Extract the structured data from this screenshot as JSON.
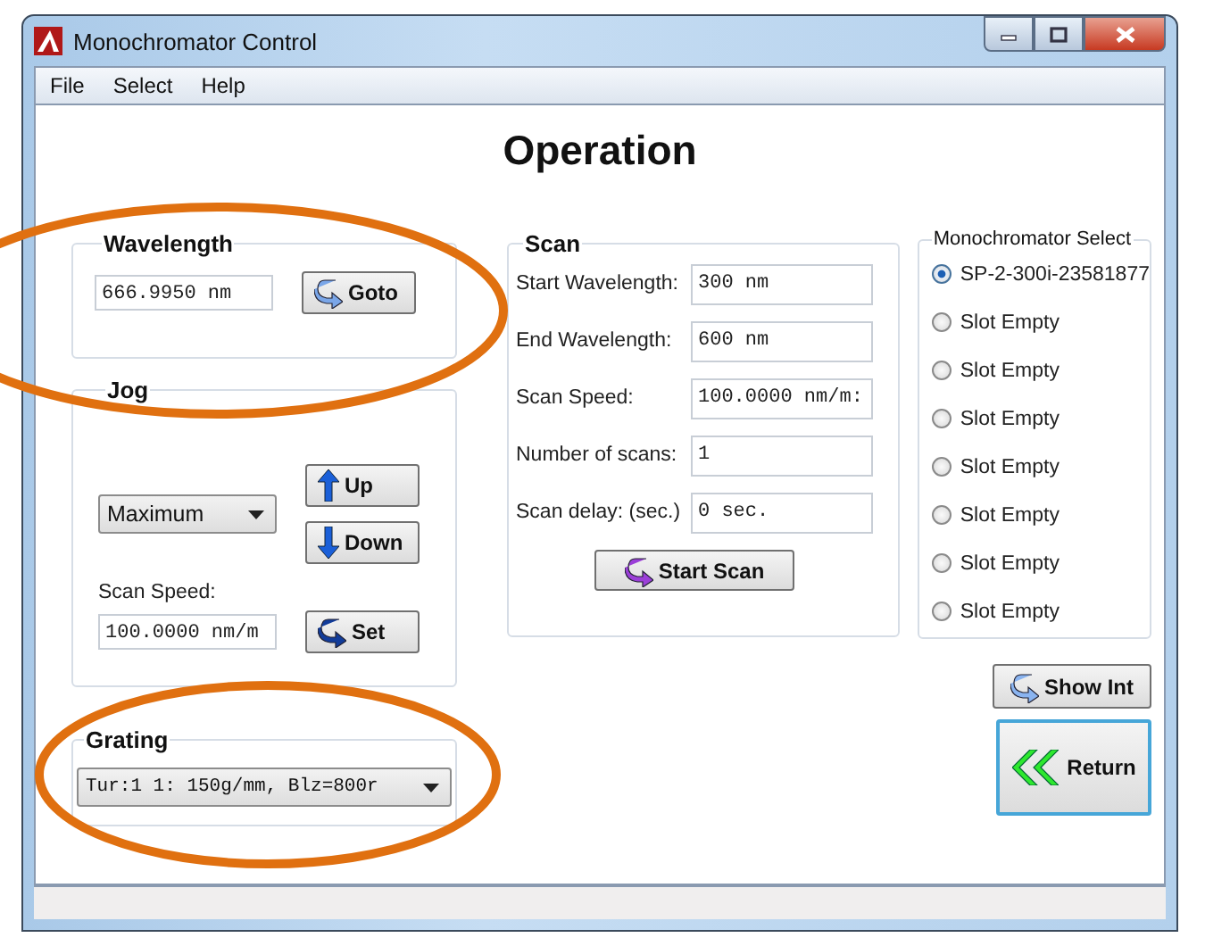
{
  "window": {
    "title": "Monochromator Control"
  },
  "menu": [
    {
      "label": "File"
    },
    {
      "label": "Select"
    },
    {
      "label": "Help"
    }
  ],
  "heading": "Operation",
  "wavelength": {
    "title": "Wavelength",
    "value": "666.9950 nm",
    "button": "Goto"
  },
  "jog": {
    "title": "Jog",
    "speed_mode": "Maximum",
    "buttons": [
      {
        "label": "Up",
        "kind": "up"
      },
      {
        "label": "Down",
        "kind": "down"
      }
    ],
    "speed_label": "Scan Speed:",
    "speed_value": "100.0000 nm/m",
    "set_button": "Set"
  },
  "grating": {
    "title": "Grating",
    "value": "Tur:1 1: 150g/mm, Blz=800r"
  },
  "scan": {
    "title": "Scan",
    "fields": [
      {
        "label": "Start Wavelength:",
        "value": "300 nm"
      },
      {
        "label": "End Wavelength:",
        "value": "600 nm"
      },
      {
        "label": "Scan Speed:",
        "value": "100.0000 nm/m:"
      },
      {
        "label": "Number of scans:",
        "value": "1"
      },
      {
        "label": "Scan delay: (sec.)",
        "value": "0 sec."
      }
    ],
    "button": "Start Scan"
  },
  "monochromator_select": {
    "title": "Monochromator Select",
    "options": [
      {
        "label": "SP-2-300i-23581877",
        "selected": true
      },
      {
        "label": "Slot Empty",
        "selected": false
      },
      {
        "label": "Slot Empty",
        "selected": false
      },
      {
        "label": "Slot Empty",
        "selected": false
      },
      {
        "label": "Slot Empty",
        "selected": false
      },
      {
        "label": "Slot Empty",
        "selected": false
      },
      {
        "label": "Slot Empty",
        "selected": false
      },
      {
        "label": "Slot Empty",
        "selected": false
      }
    ]
  },
  "buttons": [
    {
      "label": "Show Int",
      "kind": "show"
    },
    {
      "label": "Return",
      "kind": "return"
    }
  ],
  "annotations": [
    {
      "kind": "ellipse"
    },
    {
      "kind": "ellipse"
    }
  ]
}
